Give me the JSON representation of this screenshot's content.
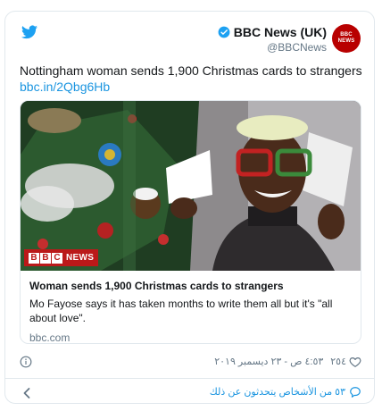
{
  "author": {
    "name": "BBC News (UK)",
    "handle": "@BBCNews",
    "avatar_text_1": "BBC",
    "avatar_text_2": "NEWS",
    "avatar_color": "#b80000"
  },
  "icons": {
    "logo": "twitter-bird-icon",
    "verified": "verified-badge-icon",
    "info": "info-icon",
    "like": "heart-icon",
    "conversation": "speech-bubble-icon",
    "back": "chevron-left-icon"
  },
  "tweet": {
    "text": "Nottingham woman sends 1,900 Christmas cards to strangers",
    "link": "bbc.in/2Qbg6Hb"
  },
  "card": {
    "badge_letters": [
      "B",
      "B",
      "C"
    ],
    "badge_word": "NEWS",
    "title": "Woman sends 1,900 Christmas cards to strangers",
    "description": "Mo Fayose says it has taken months to write them all but it's \"all about love\".",
    "domain": "bbc.com"
  },
  "meta": {
    "like_count": "٢٥٤",
    "date": "٤:٥٣ ص - ٢٣ ديسمبر ٢٠١٩"
  },
  "footer": {
    "conversation_text": "٥٣ من الأشخاص يتحدثون عن ذلك"
  },
  "colors": {
    "link_blue": "#1b95e0",
    "secondary_gray": "#657786",
    "bbc_red": "#bb1919",
    "border": "#e1e8ed"
  }
}
